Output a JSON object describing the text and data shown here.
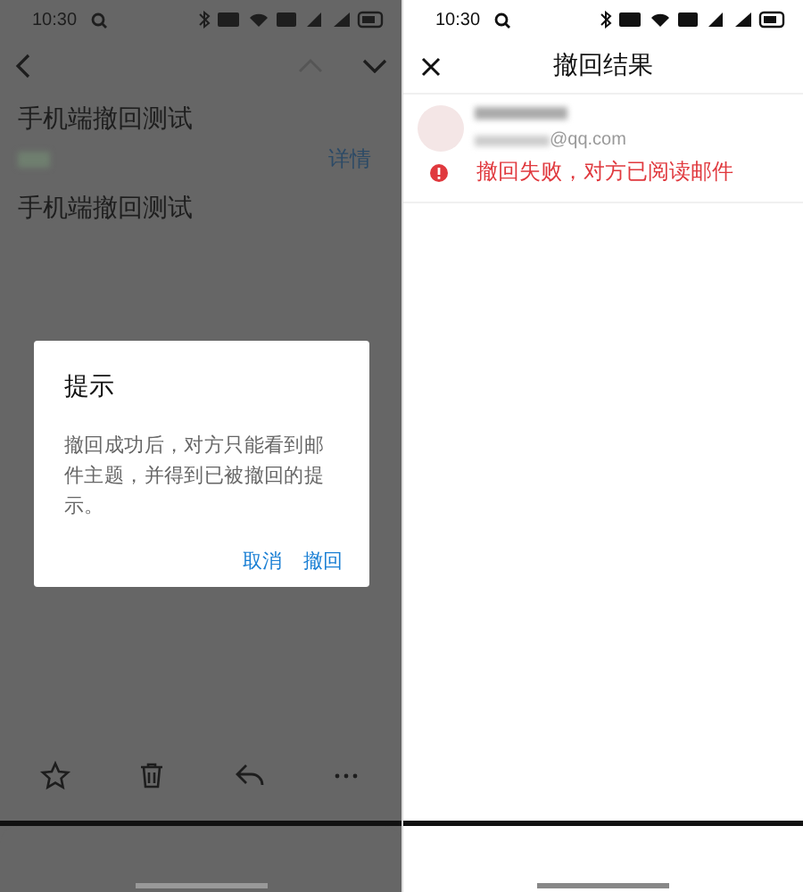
{
  "left": {
    "status_bar": {
      "time": "10:30"
    },
    "subject": "手机端撤回测试",
    "details_link": "详情",
    "body": "手机端撤回测试",
    "dialog": {
      "title": "提示",
      "message": "撤回成功后，对方只能看到邮件主题，并得到已被撤回的提示。",
      "buttons": [
        {
          "label": "取消"
        },
        {
          "label": "撤回"
        }
      ]
    },
    "toolbar": [
      {
        "kind": "star"
      },
      {
        "kind": "delete"
      },
      {
        "kind": "reply"
      },
      {
        "kind": "more"
      }
    ]
  },
  "right": {
    "status_bar": {
      "time": "10:30"
    },
    "title": "撤回结果",
    "recipients": [
      {
        "email_suffix": "@qq.com",
        "failed": true,
        "message": "撤回失败，对方已阅读邮件"
      }
    ]
  }
}
